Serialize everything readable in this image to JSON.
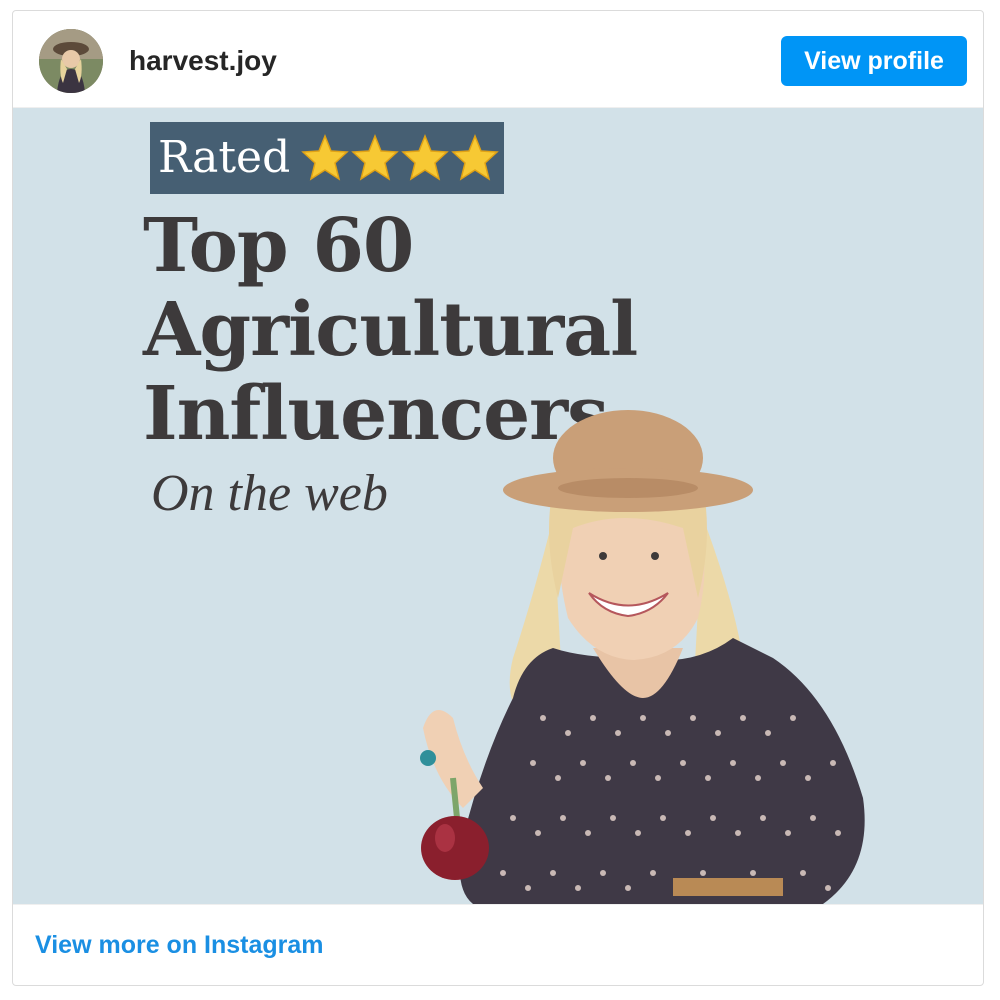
{
  "header": {
    "username": "harvest.joy",
    "view_profile_label": "View profile"
  },
  "media": {
    "badge_text": "Rated",
    "star_count": 4,
    "headline_lines": [
      "Top 60",
      "Agricultural",
      "Influencers"
    ],
    "subline": "On the web",
    "background_color": "#d2e1e8",
    "badge_color": "#465f73"
  },
  "footer": {
    "view_more_label": "View more on Instagram"
  },
  "colors": {
    "accent": "#0095f6",
    "link": "#1a8fe3",
    "text_dark": "#262626"
  }
}
